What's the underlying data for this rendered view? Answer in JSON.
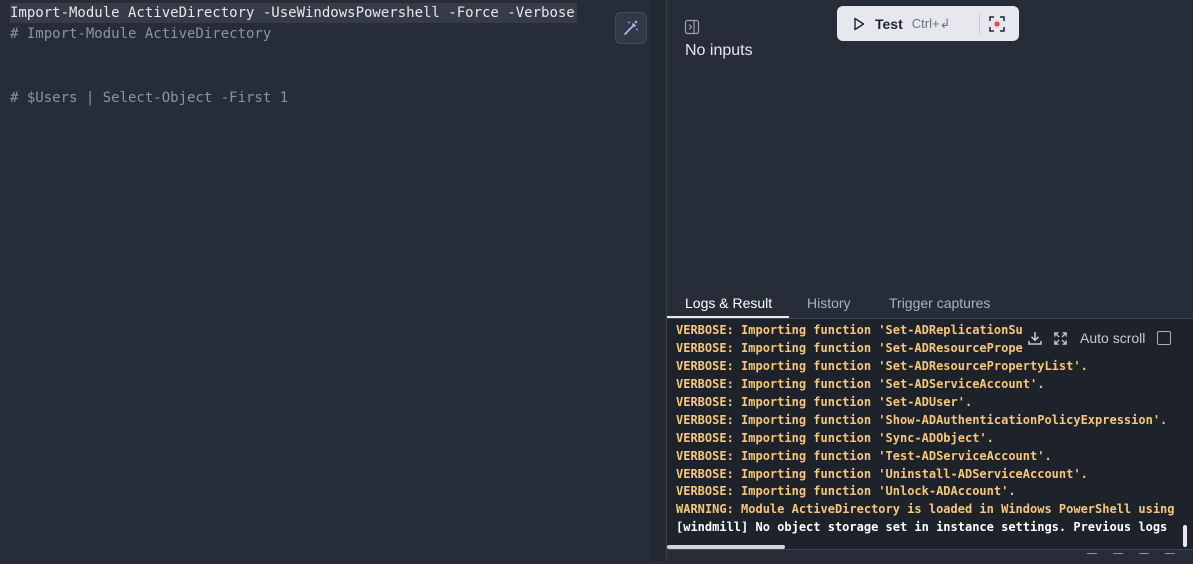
{
  "editor": {
    "lines": [
      "Import-Module ActiveDirectory -UseWindowsPowershell -Force -Verbose",
      "# Import-Module ActiveDirectory",
      "# $Users | Select-Object -First 1"
    ],
    "ai_icon": "magic-wand-icon"
  },
  "inputs": {
    "empty_label": "No inputs",
    "panel_icon": "panel-toggle-icon"
  },
  "test_button": {
    "label": "Test",
    "shortcut": "Ctrl+↲",
    "icon": "play-icon",
    "capture_icon": "capture-icon"
  },
  "tabs": [
    "Logs & Result",
    "History",
    "Trigger captures"
  ],
  "active_tab": "Logs & Result",
  "logs": {
    "lines": [
      "VERBOSE: Importing function 'Set-ADReplicationSu",
      "VERBOSE: Importing function 'Set-ADResourcePrope",
      "VERBOSE: Importing function 'Set-ADResourcePropertyList'.",
      "VERBOSE: Importing function 'Set-ADServiceAccount'.",
      "VERBOSE: Importing function 'Set-ADUser'.",
      "VERBOSE: Importing function 'Show-ADAuthenticationPolicyExpression'.",
      "VERBOSE: Importing function 'Sync-ADObject'.",
      "VERBOSE: Importing function 'Test-ADServiceAccount'.",
      "VERBOSE: Importing function 'Uninstall-ADServiceAccount'.",
      "VERBOSE: Importing function 'Unlock-ADAccount'.",
      "WARNING: Module ActiveDirectory is loaded in Windows PowerShell using",
      "[windmill] No object storage set in instance settings. Previous logs"
    ],
    "auto_scroll_label": "Auto scroll",
    "auto_scroll_checked": false,
    "toolbar_icons": [
      "download-icon",
      "expand-icon"
    ]
  },
  "colors": {
    "background": "#272d38",
    "log_background": "#1e222b",
    "log_verbose": "#f5c77a",
    "accent_button": "#e6e8ee"
  }
}
